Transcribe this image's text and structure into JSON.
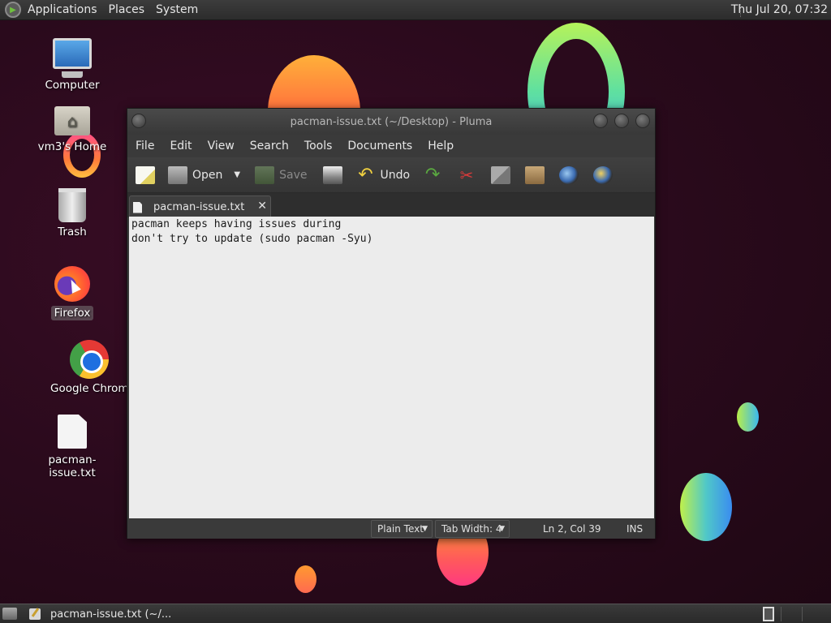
{
  "top_panel": {
    "menus": [
      "Applications",
      "Places",
      "System"
    ],
    "clock": "Thu Jul 20, 07:32"
  },
  "desktop_icons": [
    {
      "label": "Computer",
      "icon": "computer-icon"
    },
    {
      "label": "vm3's Home",
      "icon": "home-folder-icon"
    },
    {
      "label": "Trash",
      "icon": "trash-icon"
    },
    {
      "label": "Firefox",
      "icon": "firefox-icon"
    },
    {
      "label": "Google Chrome",
      "icon": "chrome-icon"
    },
    {
      "label": "pacman-issue.txt",
      "icon": "text-file-icon"
    }
  ],
  "window": {
    "title": "pacman-issue.txt (~/Desktop) - Pluma",
    "menu": [
      "File",
      "Edit",
      "View",
      "Search",
      "Tools",
      "Documents",
      "Help"
    ],
    "toolbar": {
      "open_label": "Open",
      "save_label": "Save",
      "undo_label": "Undo"
    },
    "tab": {
      "label": "pacman-issue.txt",
      "close": "✕"
    },
    "content": "pacman keeps having issues during\ndon't try to update (sudo pacman -Syu)",
    "status": {
      "language": "Plain Text",
      "tab_width": "Tab Width:  4",
      "position": "Ln 2, Col 39",
      "mode": "INS"
    }
  },
  "bottom_panel": {
    "task_label": "pacman-issue.txt (~/..."
  },
  "colors": {
    "panel_bg": "#2c2c2c",
    "editor_bg": "#ececec",
    "wallpaper_bg": "#2a0a1c"
  }
}
